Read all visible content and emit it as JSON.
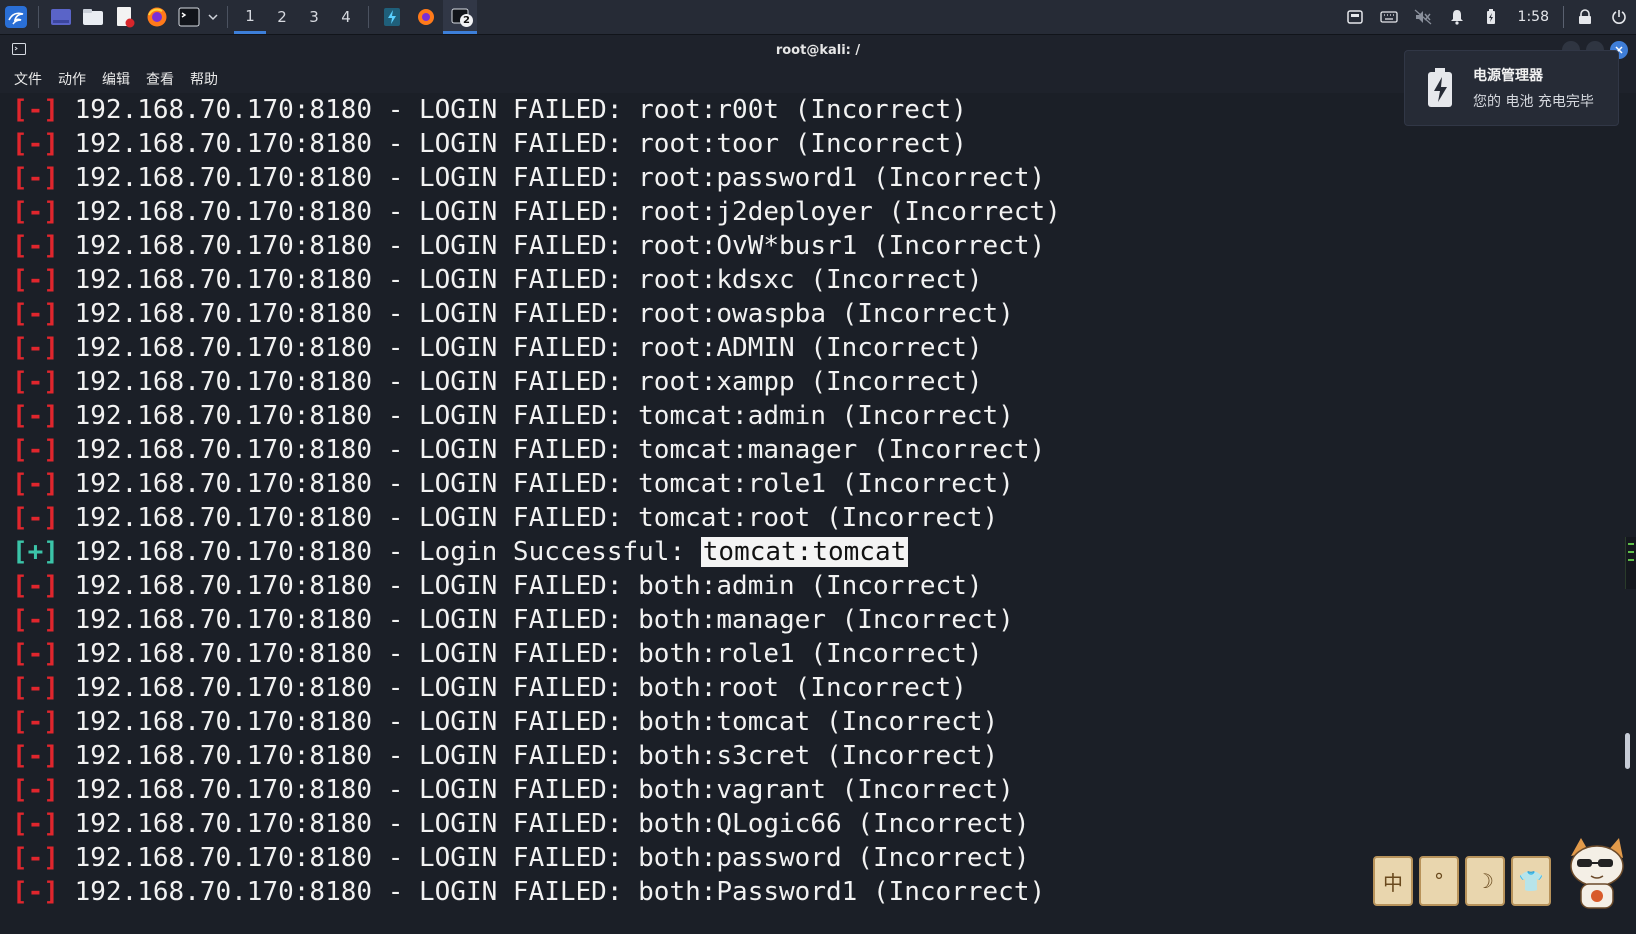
{
  "panel": {
    "apps": [
      {
        "name": "kali-menu-icon"
      },
      {
        "name": "desktop-icon"
      },
      {
        "name": "file-manager-icon"
      },
      {
        "name": "text-editor-icon"
      },
      {
        "name": "firefox-icon"
      },
      {
        "name": "terminal-icon"
      }
    ],
    "workspaces": [
      "1",
      "2",
      "3",
      "4"
    ],
    "active_workspace": "1",
    "window_badge": "2",
    "clock": "1:58"
  },
  "window": {
    "title": "root@kali: /",
    "menu": [
      "文件",
      "动作",
      "编辑",
      "查看",
      "帮助"
    ]
  },
  "notification": {
    "title": "电源管理器",
    "body": "您的 电池 充电完毕"
  },
  "terminal": {
    "lines": [
      {
        "mark": "[-]",
        "status": "fail",
        "text": " 192.168.70.170:8180 - LOGIN FAILED: root:r00t (Incorrect)"
      },
      {
        "mark": "[-]",
        "status": "fail",
        "text": " 192.168.70.170:8180 - LOGIN FAILED: root:toor (Incorrect)"
      },
      {
        "mark": "[-]",
        "status": "fail",
        "text": " 192.168.70.170:8180 - LOGIN FAILED: root:password1 (Incorrect)"
      },
      {
        "mark": "[-]",
        "status": "fail",
        "text": " 192.168.70.170:8180 - LOGIN FAILED: root:j2deployer (Incorrect)"
      },
      {
        "mark": "[-]",
        "status": "fail",
        "text": " 192.168.70.170:8180 - LOGIN FAILED: root:OvW*busr1 (Incorrect)"
      },
      {
        "mark": "[-]",
        "status": "fail",
        "text": " 192.168.70.170:8180 - LOGIN FAILED: root:kdsxc (Incorrect)"
      },
      {
        "mark": "[-]",
        "status": "fail",
        "text": " 192.168.70.170:8180 - LOGIN FAILED: root:owaspba (Incorrect)"
      },
      {
        "mark": "[-]",
        "status": "fail",
        "text": " 192.168.70.170:8180 - LOGIN FAILED: root:ADMIN (Incorrect)"
      },
      {
        "mark": "[-]",
        "status": "fail",
        "text": " 192.168.70.170:8180 - LOGIN FAILED: root:xampp (Incorrect)"
      },
      {
        "mark": "[-]",
        "status": "fail",
        "text": " 192.168.70.170:8180 - LOGIN FAILED: tomcat:admin (Incorrect)"
      },
      {
        "mark": "[-]",
        "status": "fail",
        "text": " 192.168.70.170:8180 - LOGIN FAILED: tomcat:manager (Incorrect)"
      },
      {
        "mark": "[-]",
        "status": "fail",
        "text": " 192.168.70.170:8180 - LOGIN FAILED: tomcat:role1 (Incorrect)"
      },
      {
        "mark": "[-]",
        "status": "fail",
        "text": " 192.168.70.170:8180 - LOGIN FAILED: tomcat:root (Incorrect)"
      },
      {
        "mark": "[+]",
        "status": "ok",
        "text": " 192.168.70.170:8180 - Login Successful: ",
        "highlight": "tomcat:tomcat"
      },
      {
        "mark": "[-]",
        "status": "fail",
        "text": " 192.168.70.170:8180 - LOGIN FAILED: both:admin (Incorrect)"
      },
      {
        "mark": "[-]",
        "status": "fail",
        "text": " 192.168.70.170:8180 - LOGIN FAILED: both:manager (Incorrect)"
      },
      {
        "mark": "[-]",
        "status": "fail",
        "text": " 192.168.70.170:8180 - LOGIN FAILED: both:role1 (Incorrect)"
      },
      {
        "mark": "[-]",
        "status": "fail",
        "text": " 192.168.70.170:8180 - LOGIN FAILED: both:root (Incorrect)"
      },
      {
        "mark": "[-]",
        "status": "fail",
        "text": " 192.168.70.170:8180 - LOGIN FAILED: both:tomcat (Incorrect)"
      },
      {
        "mark": "[-]",
        "status": "fail",
        "text": " 192.168.70.170:8180 - LOGIN FAILED: both:s3cret (Incorrect)"
      },
      {
        "mark": "[-]",
        "status": "fail",
        "text": " 192.168.70.170:8180 - LOGIN FAILED: both:vagrant (Incorrect)"
      },
      {
        "mark": "[-]",
        "status": "fail",
        "text": " 192.168.70.170:8180 - LOGIN FAILED: both:QLogic66 (Incorrect)"
      },
      {
        "mark": "[-]",
        "status": "fail",
        "text": " 192.168.70.170:8180 - LOGIN FAILED: both:password (Incorrect)"
      },
      {
        "mark": "[-]",
        "status": "fail",
        "text": " 192.168.70.170:8180 - LOGIN FAILED: both:Password1 (Incorrect)"
      }
    ]
  },
  "stickers": [
    "中",
    "°",
    "☽",
    "👕"
  ],
  "colors": {
    "fail_mark": "#e0262d",
    "success_mark": "#3bc4a8",
    "panel_bg": "#262b36",
    "terminal_bg": "#1b1f27",
    "accent": "#3d7fd9"
  }
}
